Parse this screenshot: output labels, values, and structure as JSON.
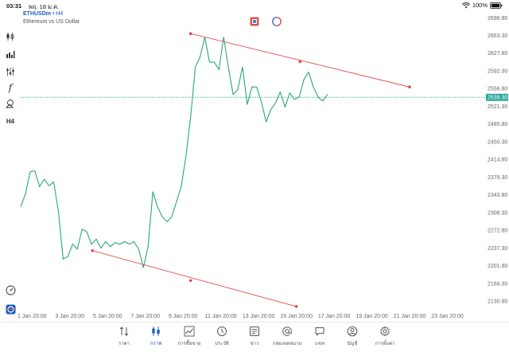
{
  "status_bar": {
    "time": "03:31",
    "date": "พฤ. 18 ม.ค.",
    "battery": "100%"
  },
  "symbol": {
    "name": "ETHUSDm",
    "separator": "•",
    "timeframe": "H4",
    "description": "Ethereum vs US Dollar"
  },
  "toolbar": {
    "timeframe_label": "H4",
    "function_label": "f"
  },
  "colors": {
    "line": "#2aa876",
    "trend": "#e04848",
    "price_tag": "#26a69a",
    "accent": "#1a5dbf"
  },
  "chart_data": {
    "type": "line",
    "x_tick_labels": [
      "1 Jan 20:00",
      "3 Jan 20:00",
      "5 Jan 20:00",
      "7 Jan 20:00",
      "9 Jan 20:00",
      "11 Jan 20:00",
      "13 Jan 20:00",
      "15 Jan 20:00",
      "17 Jan 20:00",
      "19 Jan 20:00",
      "21 Jan 20:00",
      "23 Jan 20:00"
    ],
    "y_tick_labels": [
      "2698.80",
      "2663.30",
      "2627.80",
      "2592.30",
      "2556.80",
      "2521.30",
      "2485.80",
      "2450.30",
      "2414.80",
      "2379.30",
      "2343.80",
      "2308.30",
      "2272.80",
      "2237.30",
      "2201.80",
      "2166.30",
      "2130.80"
    ],
    "ylim": [
      2115,
      2712
    ],
    "xlim": [
      0,
      24.6
    ],
    "current_price": 2539.3,
    "current_price_label": "2539.30",
    "series": [
      {
        "x": [
          0,
          0.25,
          0.5,
          0.75,
          1.0,
          1.25,
          1.5,
          1.75,
          2.0,
          2.25,
          2.5,
          2.75,
          3.0,
          3.25,
          3.5,
          3.75,
          4.0,
          4.25,
          4.5,
          4.75,
          5.0,
          5.25,
          5.5,
          5.75,
          6.0,
          6.25,
          6.5,
          6.75,
          7.0,
          7.25,
          7.5,
          7.75,
          8.0,
          8.25,
          8.5,
          8.75,
          9.0,
          9.25,
          9.5,
          9.75,
          10.0,
          10.25,
          10.5,
          10.75,
          11.0,
          11.25,
          11.5,
          11.75,
          12.0,
          12.25,
          12.5,
          12.75,
          13.0,
          13.25,
          13.5,
          13.75,
          14.0,
          14.25,
          14.5,
          14.75,
          15.0,
          15.25,
          15.5,
          15.75,
          16.0,
          16.25,
          16.5,
          16.75,
          17.0
        ],
        "y": [
          2320,
          2345,
          2390,
          2392,
          2360,
          2375,
          2362,
          2370,
          2310,
          2215,
          2220,
          2245,
          2235,
          2275,
          2270,
          2245,
          2255,
          2237,
          2250,
          2240,
          2248,
          2245,
          2250,
          2245,
          2250,
          2235,
          2198,
          2240,
          2350,
          2320,
          2300,
          2290,
          2300,
          2330,
          2360,
          2420,
          2500,
          2600,
          2620,
          2660,
          2610,
          2610,
          2595,
          2660,
          2600,
          2545,
          2555,
          2600,
          2525,
          2560,
          2560,
          2530,
          2490,
          2515,
          2528,
          2550,
          2520,
          2548,
          2535,
          2540,
          2575,
          2590,
          2560,
          2540,
          2532,
          2545,
          null,
          null,
          null
        ]
      }
    ],
    "trendlines": [
      {
        "x": [
          9.0,
          14.8,
          20.6
        ],
        "y": [
          2667,
          2611,
          2560
        ]
      },
      {
        "x": [
          3.8,
          9.0,
          14.6
        ],
        "y": [
          2232,
          2172,
          2120
        ]
      }
    ]
  },
  "bottom_nav": {
    "items": [
      {
        "label": "ราคา",
        "icon": "arrows-updown-icon"
      },
      {
        "label": "กราฟ",
        "icon": "candles-icon"
      },
      {
        "label": "การซื้อขาย",
        "icon": "trend-chart-icon"
      },
      {
        "label": "ประวัติ",
        "icon": "history-icon"
      },
      {
        "label": "ข่าว",
        "icon": "news-icon"
      },
      {
        "label": "กล่องจดหมาย",
        "icon": "at-icon"
      },
      {
        "label": "แชท",
        "icon": "chat-icon"
      },
      {
        "label": "บัญชี",
        "icon": "account-icon"
      },
      {
        "label": "การตั้งค่า",
        "icon": "gear-icon"
      }
    ],
    "active_index": 1
  }
}
